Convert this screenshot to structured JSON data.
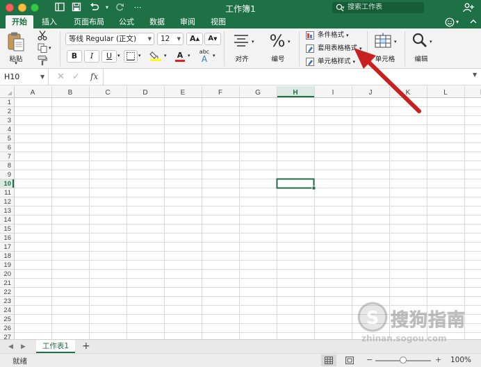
{
  "window": {
    "title": "工作簿1",
    "search_placeholder": "搜索工作表"
  },
  "tabs": [
    {
      "label": "开始",
      "active": true
    },
    {
      "label": "插入"
    },
    {
      "label": "页面布局"
    },
    {
      "label": "公式"
    },
    {
      "label": "数据"
    },
    {
      "label": "审阅"
    },
    {
      "label": "视图"
    }
  ],
  "ribbon": {
    "paste_label": "粘贴",
    "font_name": "等线 Regular (正文)",
    "font_size": "12",
    "grow_font": "A",
    "shrink_font": "A",
    "bold": "B",
    "italic": "I",
    "underline": "U",
    "font_color_glyph": "A",
    "phonetic_glyph": "abc",
    "phonetic_sub": "A",
    "align_label": "对齐",
    "number_glyph": "%",
    "number_label": "编号",
    "conditional_format": "条件格式",
    "table_format": "套用表格格式",
    "cell_styles": "单元格样式",
    "cells_label": "单元格",
    "edit_label": "编辑"
  },
  "formula_bar": {
    "name_box": "H10",
    "fx": "fx",
    "formula": ""
  },
  "grid": {
    "columns": [
      "A",
      "B",
      "C",
      "D",
      "E",
      "F",
      "G",
      "H",
      "I",
      "J",
      "K",
      "L",
      "M"
    ],
    "rows": [
      1,
      2,
      3,
      4,
      5,
      6,
      7,
      8,
      9,
      10,
      11,
      12,
      13,
      14,
      15,
      16,
      17,
      18,
      19,
      20,
      21,
      22,
      23,
      24,
      25,
      26,
      27
    ],
    "active_col": "H",
    "active_row": 10
  },
  "sheets": {
    "tabs": [
      "工作表1"
    ],
    "add_glyph": "+"
  },
  "status": {
    "text": "就绪",
    "zoom": "100%",
    "zoom_minus": "−",
    "zoom_plus": "+"
  },
  "watermark": {
    "cn": "搜狗指南",
    "url": "zhinan.sogou.com"
  },
  "colors": {
    "accent": "#1e7145",
    "arrow": "#c8201f"
  }
}
